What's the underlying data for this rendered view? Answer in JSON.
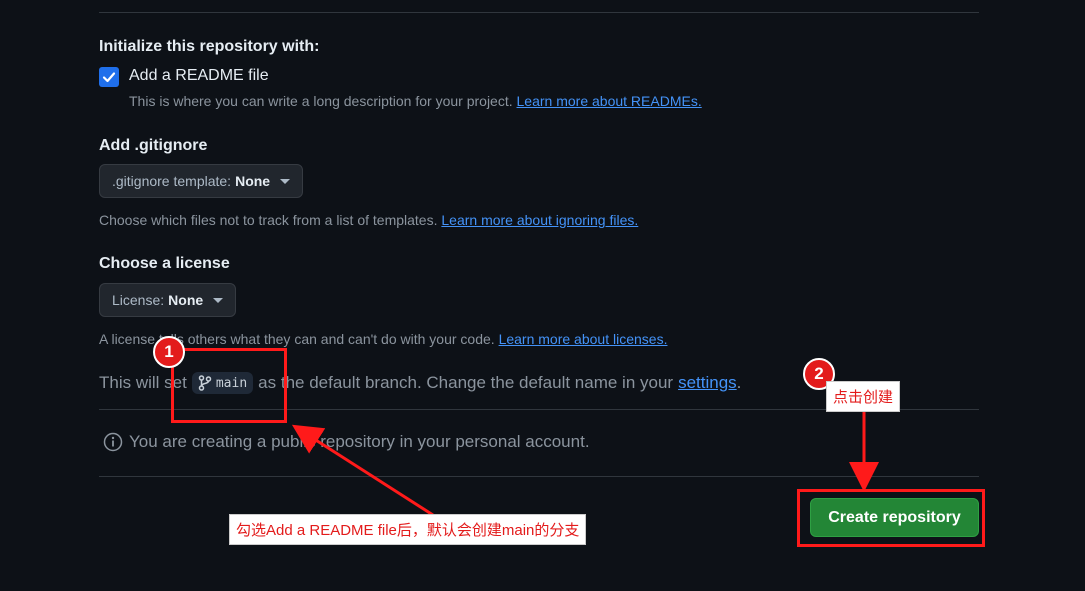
{
  "init_section": {
    "title": "Initialize this repository with:",
    "readme_checkbox": {
      "label": "Add a README file",
      "checked": true,
      "description": "This is where you can write a long description for your project.",
      "link": "Learn more about READMEs."
    }
  },
  "gitignore_section": {
    "title": "Add .gitignore",
    "dropdown_label": ".gitignore template:",
    "dropdown_value": "None",
    "description": "Choose which files not to track from a list of templates.",
    "link": "Learn more about ignoring files."
  },
  "license_section": {
    "title": "Choose a license",
    "dropdown_label": "License:",
    "dropdown_value": "None",
    "description": "A license tells others what they can and can't do with your code.",
    "link": "Learn more about licenses."
  },
  "branch_notice": {
    "prefix": "This will set",
    "branch_name": "main",
    "suffix": "as the default branch. Change the default name in your",
    "link": "settings",
    "end": "."
  },
  "visibility_notice": {
    "text": "You are creating a public repository in your personal account."
  },
  "create_button": {
    "label": "Create repository"
  },
  "annotations": {
    "badge_1": "1",
    "badge_2": "2",
    "callout_1": "勾选Add a README file后，默认会创建main的分支",
    "callout_2": "点击创建"
  },
  "colors": {
    "background": "#0d1117",
    "accent_link": "#4493f8",
    "button_green": "#238636",
    "annotation_red": "#ff1a1a"
  }
}
